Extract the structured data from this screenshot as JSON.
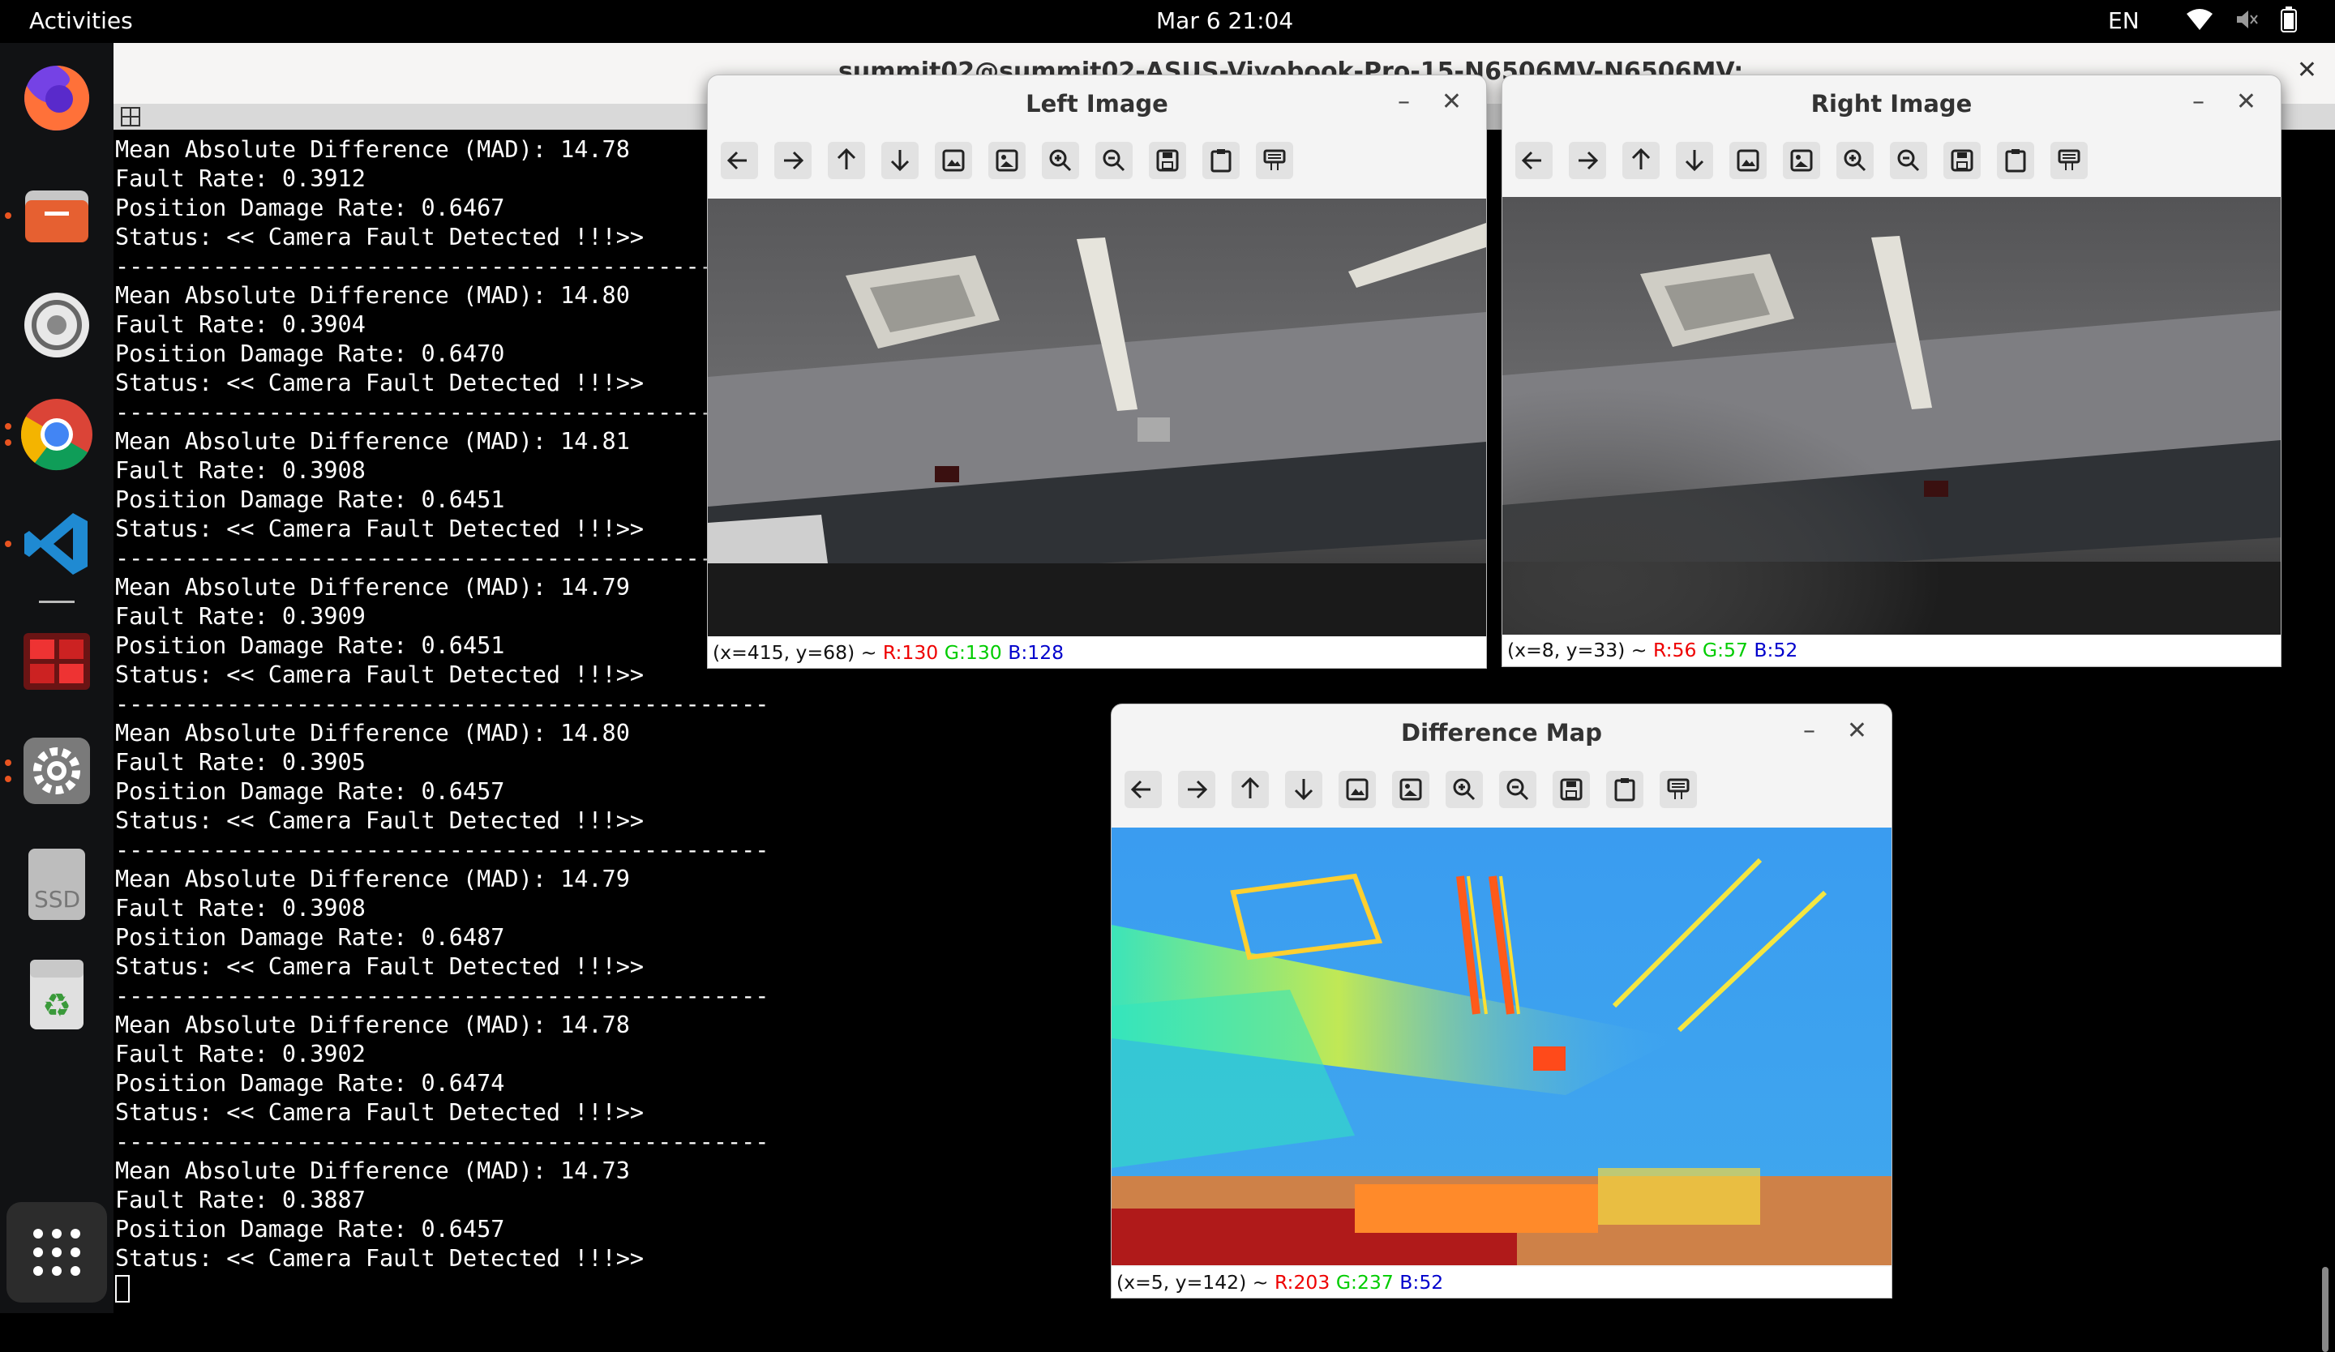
{
  "topbar": {
    "activities": "Activities",
    "clock": "Mar 6  21:04",
    "lang": "EN"
  },
  "dock": {
    "items": [
      "firefox",
      "files",
      "system-settings-wheel",
      "chrome",
      "vscode",
      "app-dashboard",
      "settings",
      "ssd-drive",
      "trash",
      "show-apps"
    ],
    "ssd_label": "SSD"
  },
  "terminal": {
    "title": "summit02@summit02-ASUS-Vivobook-Pro-15-N6506MV-N6506MV:",
    "separator": "-----------------------------------------------",
    "blocks": [
      {
        "mad": "Mean Absolute Difference (MAD): 14.78",
        "fault": "Fault Rate: 0.3912",
        "damage": "Position Damage Rate: 0.6467",
        "status": "Status: << Camera Fault Detected !!!>>"
      },
      {
        "mad": "Mean Absolute Difference (MAD): 14.80",
        "fault": "Fault Rate: 0.3904",
        "damage": "Position Damage Rate: 0.6470",
        "status": "Status: << Camera Fault Detected !!!>>"
      },
      {
        "mad": "Mean Absolute Difference (MAD): 14.81",
        "fault": "Fault Rate: 0.3908",
        "damage": "Position Damage Rate: 0.6451",
        "status": "Status: << Camera Fault Detected !!!>>"
      },
      {
        "mad": "Mean Absolute Difference (MAD): 14.79",
        "fault": "Fault Rate: 0.3909",
        "damage": "Position Damage Rate: 0.6451",
        "status": "Status: << Camera Fault Detected !!!>>"
      },
      {
        "mad": "Mean Absolute Difference (MAD): 14.80",
        "fault": "Fault Rate: 0.3905",
        "damage": "Position Damage Rate: 0.6457",
        "status": "Status: << Camera Fault Detected !!!>>"
      },
      {
        "mad": "Mean Absolute Difference (MAD): 14.79",
        "fault": "Fault Rate: 0.3908",
        "damage": "Position Damage Rate: 0.6487",
        "status": "Status: << Camera Fault Detected !!!>>"
      },
      {
        "mad": "Mean Absolute Difference (MAD): 14.78",
        "fault": "Fault Rate: 0.3902",
        "damage": "Position Damage Rate: 0.6474",
        "status": "Status: << Camera Fault Detected !!!>>"
      },
      {
        "mad": "Mean Absolute Difference (MAD): 14.73",
        "fault": "Fault Rate: 0.3887",
        "damage": "Position Damage Rate: 0.6457",
        "status": "Status: << Camera Fault Detected !!!>>"
      }
    ]
  },
  "toolbar_icons": [
    "pan-left-icon",
    "pan-right-icon",
    "pan-up-icon",
    "pan-down-icon",
    "zoom-fit-icon",
    "zoom-original-icon",
    "zoom-in-icon",
    "zoom-out-icon",
    "save-icon",
    "copy-clipboard-icon",
    "properties-icon"
  ],
  "windows": {
    "left": {
      "title": "Left Image",
      "coord": "(x=415, y=68) ~",
      "r": "R:130",
      "g": "G:130",
      "b": "B:128"
    },
    "right": {
      "title": "Right Image",
      "coord": "(x=8, y=33) ~",
      "r": "R:56",
      "g": "G:57",
      "b": "B:52"
    },
    "diff": {
      "title": "Difference Map",
      "coord": "(x=5, y=142) ~",
      "r": "R:203",
      "g": "G:237",
      "b": "B:52"
    }
  },
  "colors": {
    "accent_orange": "#e95420",
    "status_red": "#e00000",
    "status_green": "#00c000",
    "status_blue": "#0000cc",
    "diff_base": "#3fa0ef"
  }
}
